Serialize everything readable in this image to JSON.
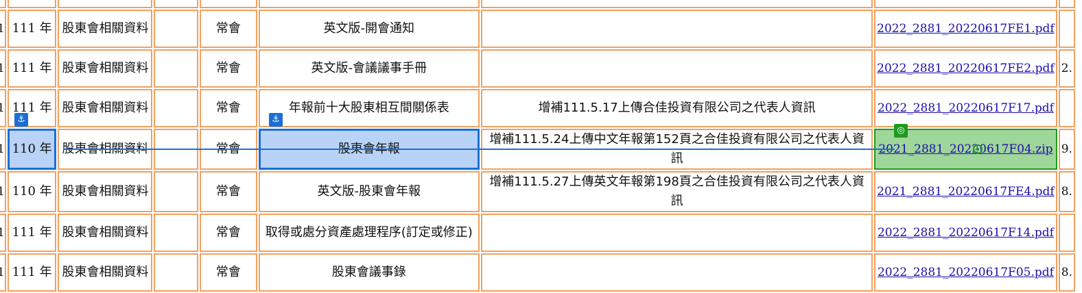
{
  "top_row": {
    "stub": "1",
    "cells": [
      "",
      "",
      "",
      "",
      "",
      "",
      "",
      "",
      ""
    ]
  },
  "rows": [
    {
      "stub": "1",
      "year": "111 年",
      "category": "股東會相關資料",
      "blank": "",
      "type": "常會",
      "name": "英文版-開會通知",
      "note": "",
      "file": "2022_2881_20220617FE1.pdf",
      "size": ""
    },
    {
      "stub": "1",
      "year": "111 年",
      "category": "股東會相關資料",
      "blank": "",
      "type": "常會",
      "name": "英文版-會議議事手冊",
      "note": "",
      "file": "2022_2881_20220617FE2.pdf",
      "size": "2."
    },
    {
      "stub": "1",
      "year": "111 年",
      "category": "股東會相關資料",
      "blank": "",
      "type": "常會",
      "name": "年報前十大股東相互間關係表",
      "note": "增補111.5.17上傳合佳投資有限公司之代表人資訊",
      "file": "2022_2881_20220617F17.pdf",
      "size": ""
    },
    {
      "stub": "1",
      "year": "110 年",
      "category": "股東會相關資料",
      "blank": "",
      "type": "常會",
      "name": "股東會年報",
      "note": "增補111.5.24上傳中文年報第152頁之合佳投資有限公司之代表人資訊",
      "file": "2021_2881_20220617F04.zip",
      "size": "9."
    },
    {
      "stub": "1",
      "year": "110 年",
      "category": "股東會相關資料",
      "blank": "",
      "type": "常會",
      "name": "英文版-股東會年報",
      "note": "增補111.5.27上傳英文年報第198頁之合佳投資有限公司之代表人資訊",
      "file": "2021_2881_20220617FE4.pdf",
      "size": "8."
    },
    {
      "stub": "1",
      "year": "111 年",
      "category": "股東會相關資料",
      "blank": "",
      "type": "常會",
      "name": "取得或處分資產處理程序(訂定或修正)",
      "note": "",
      "file": "2022_2881_20220617F14.pdf",
      "size": ""
    },
    {
      "stub": "1",
      "year": "111 年",
      "category": "股東會相關資料",
      "blank": "",
      "type": "常會",
      "name": "股東會議事錄",
      "note": "",
      "file": "2022_2881_20220617F05.pdf",
      "size": "8."
    }
  ],
  "overlay": {
    "anchor_icon": "anchor-icon",
    "target_icon": "target-icon",
    "anchor_glyph": "⚓",
    "target_glyph": "◎",
    "blue": "#1a6fd6",
    "green": "#1e9a1e"
  }
}
